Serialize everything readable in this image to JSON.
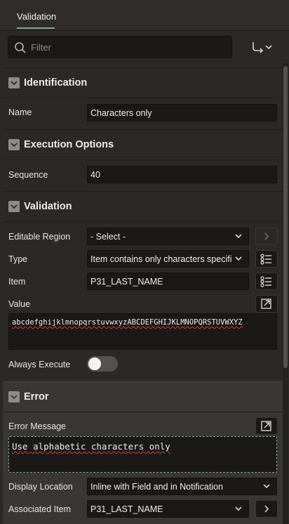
{
  "header": {
    "tab_label": "Validation"
  },
  "toolbar": {
    "filter_placeholder": "Filter"
  },
  "sections": {
    "identification": {
      "title": "Identification",
      "name_label": "Name",
      "name_value": "Characters only"
    },
    "execution": {
      "title": "Execution Options",
      "sequence_label": "Sequence",
      "sequence_value": "40"
    },
    "validation": {
      "title": "Validation",
      "editable_region_label": "Editable Region",
      "editable_region_value": "- Select -",
      "type_label": "Type",
      "type_value": "Item contains only characters specifi",
      "item_label": "Item",
      "item_value": "P31_LAST_NAME",
      "value_label": "Value",
      "value_text": "abcdefghijklmnopqrstuvwxyzABCDEFGHIJKLMNOPQRSTUVWXYZ",
      "always_execute_label": "Always Execute",
      "always_execute_on": false
    },
    "error": {
      "title": "Error",
      "message_label": "Error Message",
      "message_text": "Use alphabetic characters only",
      "display_location_label": "Display Location",
      "display_location_value": "Inline with Field and in Notification",
      "associated_item_label": "Associated Item",
      "associated_item_value": "P31_LAST_NAME"
    }
  },
  "colors": {
    "accent": "#7fa790",
    "background": "#2b2926",
    "field": "#1a1917",
    "error_bg": "#393733"
  }
}
